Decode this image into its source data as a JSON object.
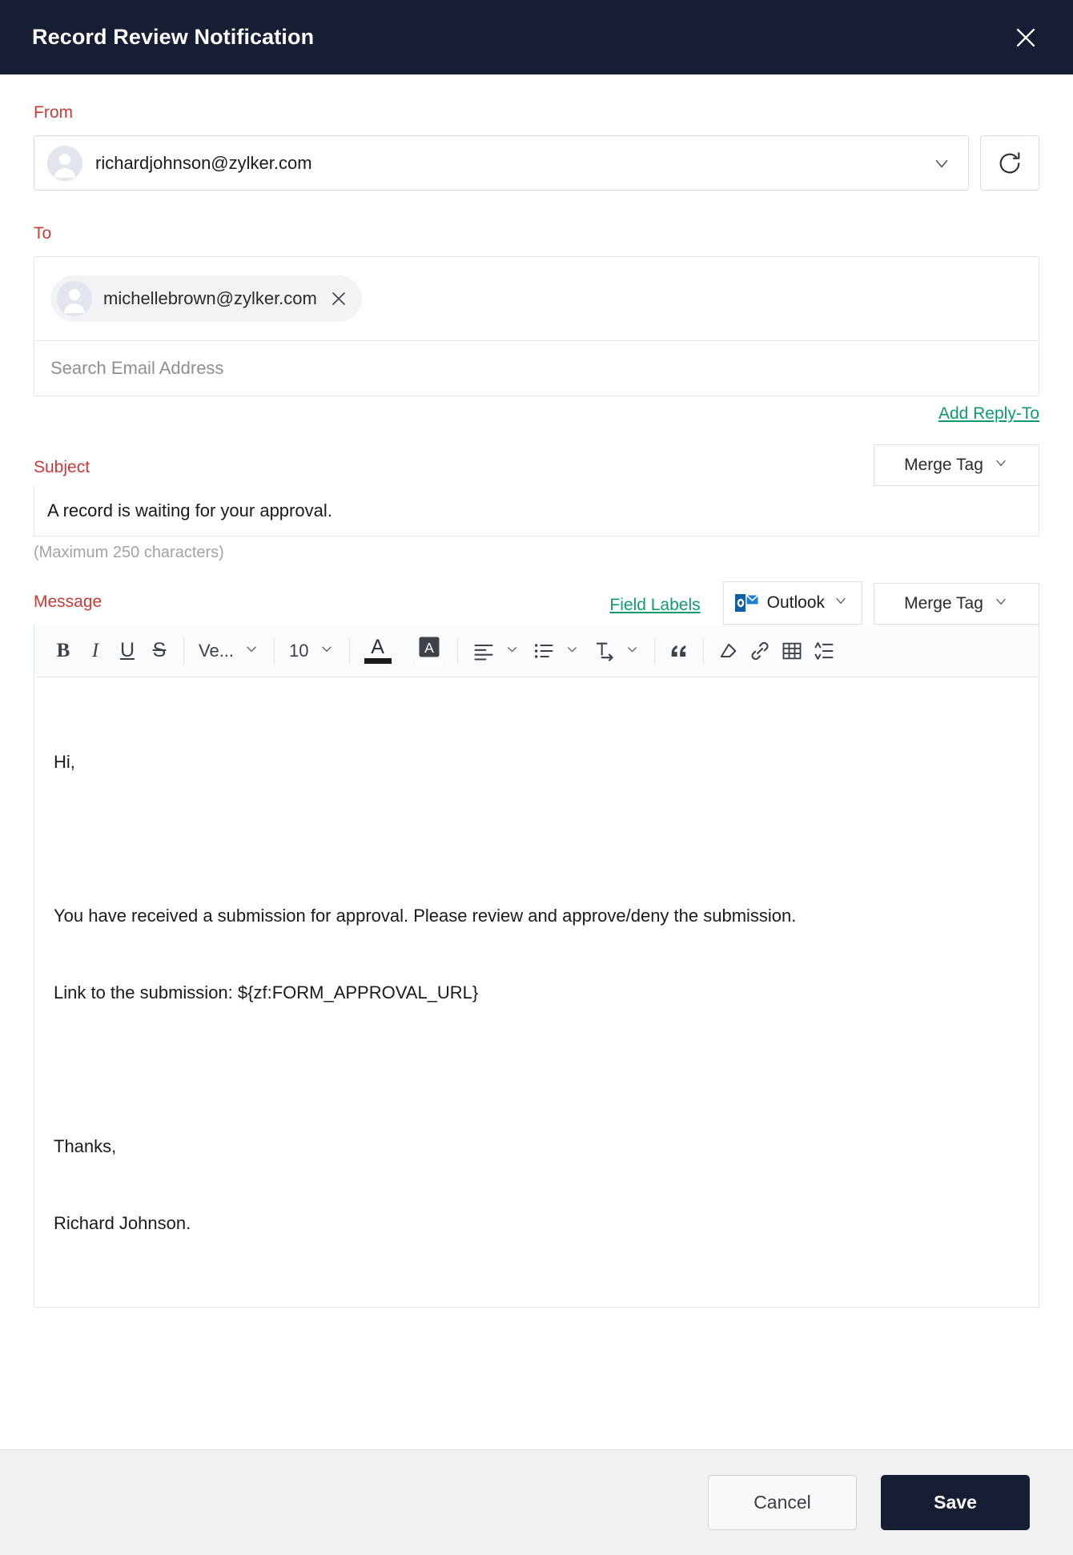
{
  "header": {
    "title": "Record Review Notification",
    "close_icon": "close-icon"
  },
  "from": {
    "label": "From",
    "email": "richardjohnson@zylker.com",
    "avatar_icon": "avatar-icon",
    "chevron_icon": "chevron-down-icon",
    "refresh_icon": "refresh-icon"
  },
  "to": {
    "label": "To",
    "chips": [
      {
        "email": "michellebrown@zylker.com",
        "remove_icon": "close-icon",
        "avatar_icon": "avatar-icon"
      }
    ],
    "search_placeholder": "Search Email Address",
    "search_value": "",
    "add_reply_to": "Add Reply-To"
  },
  "subject": {
    "label": "Subject",
    "merge_tag_label": "Merge Tag",
    "value": "A record is waiting for your approval.",
    "hint": "(Maximum 250 characters)"
  },
  "message": {
    "label": "Message",
    "field_labels_link": "Field Labels",
    "outlook_label": "Outlook",
    "merge_tag_label": "Merge Tag",
    "toolbar": {
      "bold": "B",
      "italic": "I",
      "underline": "U",
      "strikethrough": "S",
      "font_family": "Ve...",
      "font_size": "10",
      "text_color_icon": "text-color-icon",
      "highlight_icon": "highlight-color-icon",
      "align_icon": "align-left-icon",
      "list_icon": "bullet-list-icon",
      "indent_icon": "text-indent-icon",
      "quote_icon": "blockquote-icon",
      "eraser_icon": "clear-format-icon",
      "link_icon": "insert-link-icon",
      "table_icon": "insert-table-icon",
      "line_height_icon": "line-height-icon"
    },
    "body": {
      "greeting": "Hi,",
      "para1": "You have received a submission for approval. Please review and approve/deny the submission.",
      "para2": "Link to the submission: ${zf:FORM_APPROVAL_URL}",
      "closing": "Thanks,",
      "signature": "Richard Johnson."
    }
  },
  "footer": {
    "cancel_label": "Cancel",
    "save_label": "Save"
  },
  "colors": {
    "header_bg": "#151e33",
    "label_red": "#cc3a3a",
    "link_green": "#0f9b6c",
    "save_bg": "#151e33",
    "footer_bg": "#f1f1f1"
  }
}
